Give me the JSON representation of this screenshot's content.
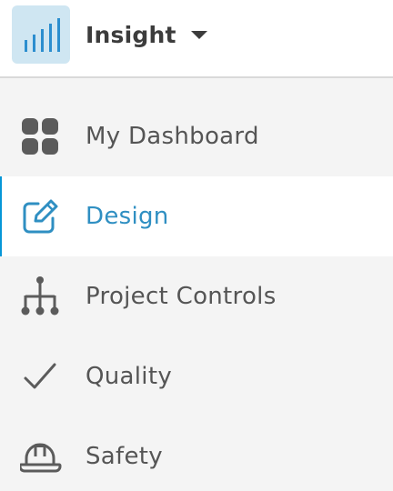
{
  "header": {
    "app_name": "Insight",
    "app_icon": "bar-chart-icon",
    "dropdown_icon": "caret-down-icon"
  },
  "nav": {
    "items": [
      {
        "label": "My Dashboard",
        "icon": "dashboard-grid-icon",
        "active": false
      },
      {
        "label": "Design",
        "icon": "edit-icon",
        "active": true
      },
      {
        "label": "Project Controls",
        "icon": "hierarchy-icon",
        "active": false
      },
      {
        "label": "Quality",
        "icon": "checkmark-icon",
        "active": false
      },
      {
        "label": "Safety",
        "icon": "hard-hat-icon",
        "active": false
      }
    ]
  },
  "colors": {
    "accent": "#0696d7",
    "active_text": "#2f8fc2",
    "text": "#555555",
    "header_text": "#3c3c3c",
    "sidebar_bg": "#f4f4f4",
    "active_bg": "#ffffff",
    "tile_bg": "#cfe6f2"
  }
}
